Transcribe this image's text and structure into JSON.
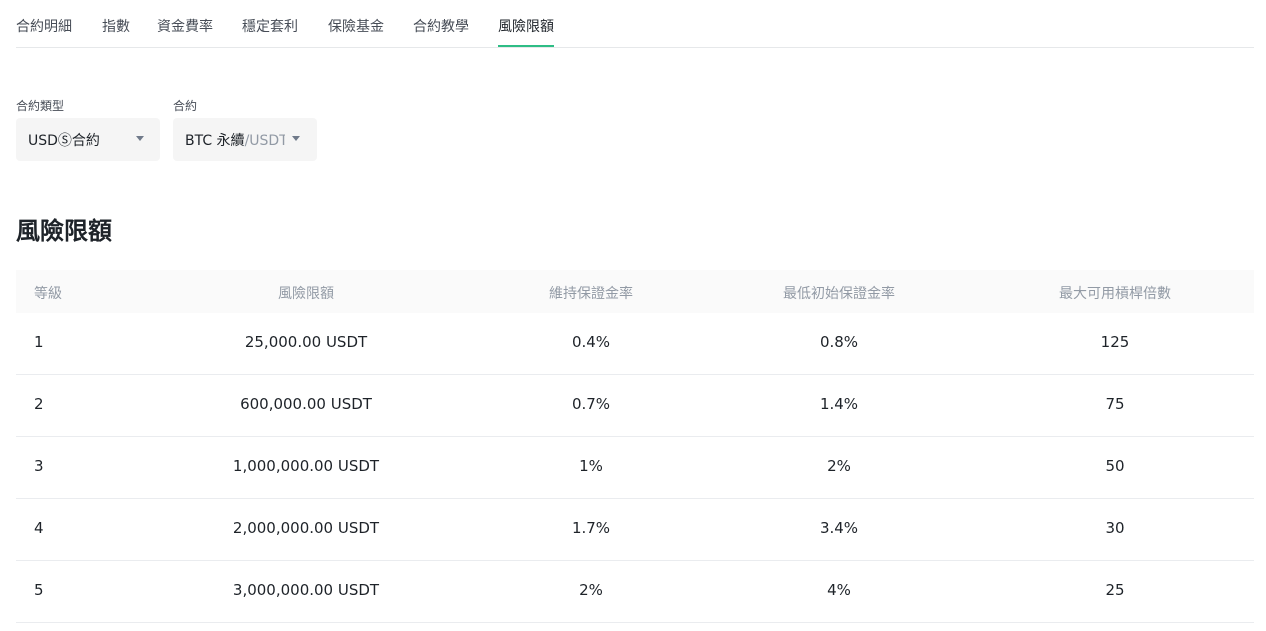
{
  "tabs": [
    {
      "label": "合約明細"
    },
    {
      "label": "指數"
    },
    {
      "label": "資金費率"
    },
    {
      "label": "穩定套利"
    },
    {
      "label": "保險基金"
    },
    {
      "label": "合約教學"
    },
    {
      "label": "風險限額"
    }
  ],
  "active_tab": "風險限額",
  "filters": {
    "contract_type": {
      "label": "合約類型",
      "value": "USDⓈ合約"
    },
    "contract": {
      "label": "合約",
      "value_main": "BTC 永續",
      "value_suffix": "/USDT"
    }
  },
  "section_title": "風險限額",
  "table": {
    "headers": [
      "等級",
      "風險限額",
      "維持保證金率",
      "最低初始保證金率",
      "最大可用槓桿倍數"
    ],
    "rows": [
      [
        "1",
        "25,000.00 USDT",
        "0.4%",
        "0.8%",
        "125"
      ],
      [
        "2",
        "600,000.00 USDT",
        "0.7%",
        "1.4%",
        "75"
      ],
      [
        "3",
        "1,000,000.00 USDT",
        "1%",
        "2%",
        "50"
      ],
      [
        "4",
        "2,000,000.00 USDT",
        "1.7%",
        "3.4%",
        "30"
      ],
      [
        "5",
        "3,000,000.00 USDT",
        "2%",
        "4%",
        "25"
      ]
    ]
  },
  "colors": {
    "accent": "#2ebd85",
    "text_primary": "#1e2329",
    "text_muted": "#929aa5",
    "select_bg": "#f5f5f5",
    "header_bg": "#fafafa"
  },
  "icons": {
    "dropdown": "caret-down-icon"
  }
}
